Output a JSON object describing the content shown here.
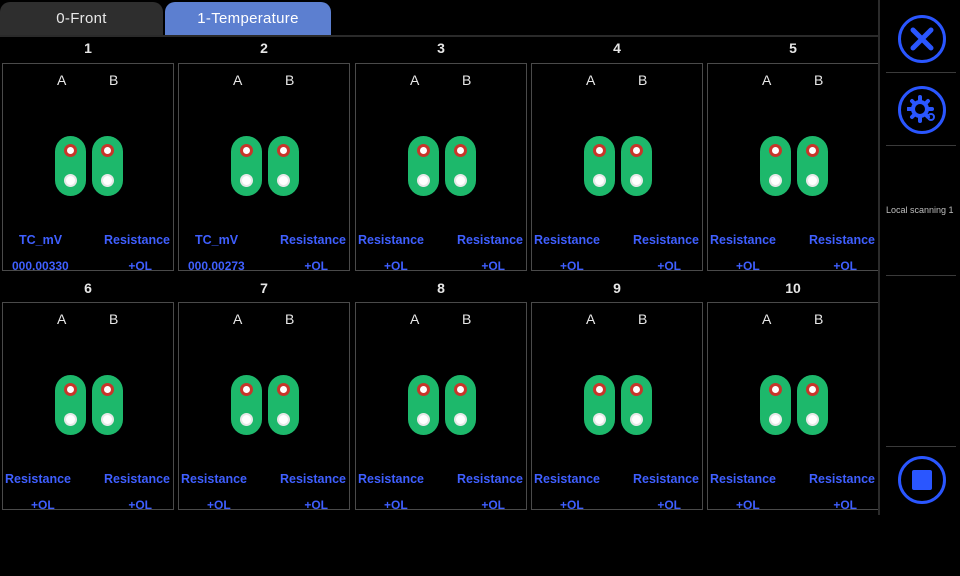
{
  "tabs": [
    {
      "label": "0-Front"
    },
    {
      "label": "1-Temperature"
    }
  ],
  "columns": [
    "1",
    "2",
    "3",
    "4",
    "5",
    "6",
    "7",
    "8",
    "9",
    "10"
  ],
  "pin_labels": {
    "a": "A",
    "b": "B"
  },
  "cells": [
    {
      "type_a": "TC_mV",
      "type_b": "Resistance",
      "val_a": "000.00330",
      "val_b": "+OL"
    },
    {
      "type_a": "TC_mV",
      "type_b": "Resistance",
      "val_a": "000.00273",
      "val_b": "+OL"
    },
    {
      "type_a": "Resistance",
      "type_b": "Resistance",
      "val_a": "+OL",
      "val_b": "+OL"
    },
    {
      "type_a": "Resistance",
      "type_b": "Resistance",
      "val_a": "+OL",
      "val_b": "+OL"
    },
    {
      "type_a": "Resistance",
      "type_b": "Resistance",
      "val_a": "+OL",
      "val_b": "+OL"
    },
    {
      "type_a": "Resistance",
      "type_b": "Resistance",
      "val_a": "+OL",
      "val_b": "+OL"
    },
    {
      "type_a": "Resistance",
      "type_b": "Resistance",
      "val_a": "+OL",
      "val_b": "+OL"
    },
    {
      "type_a": "Resistance",
      "type_b": "Resistance",
      "val_a": "+OL",
      "val_b": "+OL"
    },
    {
      "type_a": "Resistance",
      "type_b": "Resistance",
      "val_a": "+OL",
      "val_b": "+OL"
    },
    {
      "type_a": "Resistance",
      "type_b": "Resistance",
      "val_a": "+OL",
      "val_b": "+OL"
    }
  ],
  "right_panel": {
    "close_icon": "close-icon",
    "settings_icon": "gear-icon",
    "status_text": "Local scanning 1",
    "stop_icon": "stop-icon"
  },
  "colors": {
    "accent": "#2a56ff",
    "pin_green": "#1db86b",
    "value_blue": "#3f5fff",
    "tab_active": "#5c7fd0"
  }
}
